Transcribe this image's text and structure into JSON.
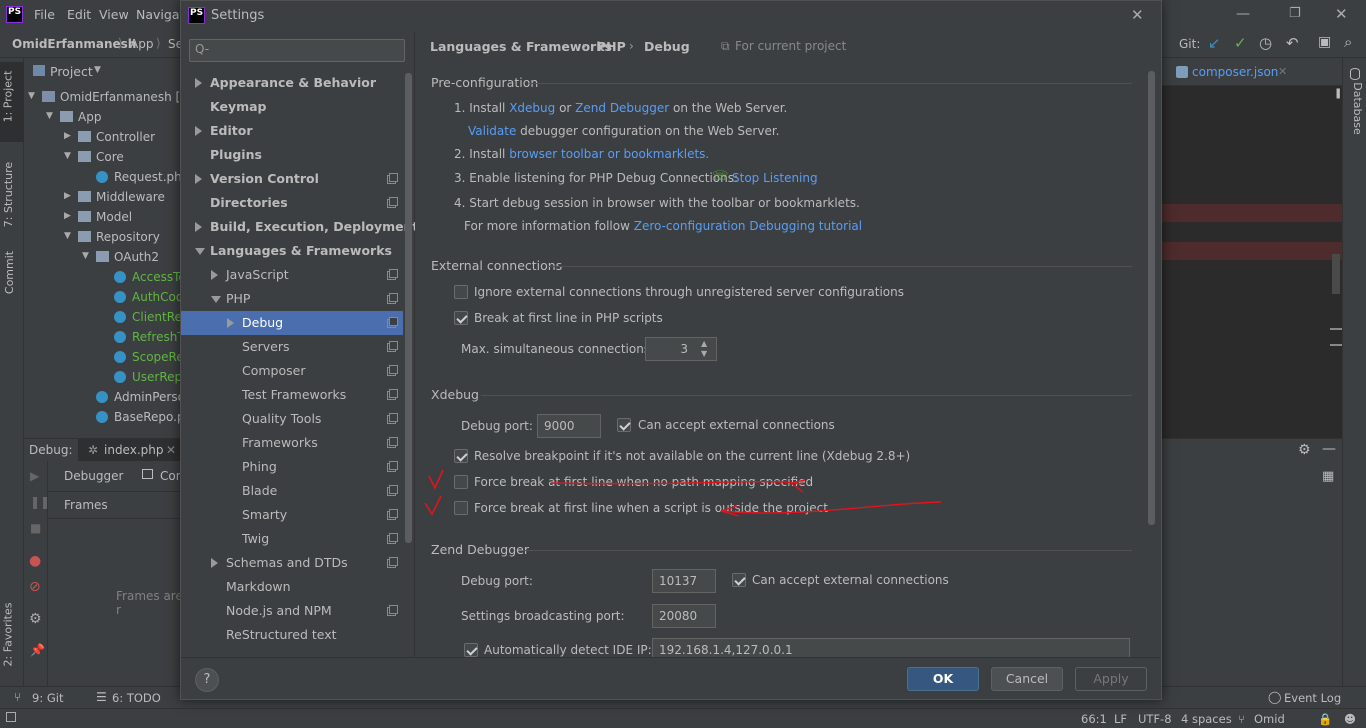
{
  "ide": {
    "menu": [
      "File",
      "Edit",
      "View",
      "Navigate"
    ],
    "breadcrumb": [
      "OmidErfanmanesh",
      "App",
      "Se"
    ],
    "vcs_label": "Git:",
    "project_tool": "Project",
    "left_stripe": [
      "1: Project",
      "7: Structure",
      "Commit",
      "2: Favorites"
    ],
    "right_stripe": [
      "Database"
    ],
    "editor_tab": "composer.json",
    "tree": [
      {
        "label": "OmidErfanmanesh [Pe",
        "indent": 0,
        "type": "module",
        "open": true
      },
      {
        "label": "App",
        "indent": 1,
        "type": "folder",
        "open": true
      },
      {
        "label": "Controller",
        "indent": 2,
        "type": "folder",
        "open": false
      },
      {
        "label": "Core",
        "indent": 2,
        "type": "folder",
        "open": true
      },
      {
        "label": "Request.php",
        "indent": 3,
        "type": "class",
        "open": null
      },
      {
        "label": "Middleware",
        "indent": 2,
        "type": "folder",
        "open": false
      },
      {
        "label": "Model",
        "indent": 2,
        "type": "folder",
        "open": false
      },
      {
        "label": "Repository",
        "indent": 2,
        "type": "folder",
        "open": true
      },
      {
        "label": "OAuth2",
        "indent": 3,
        "type": "folder",
        "open": true
      },
      {
        "label": "AccessTo",
        "indent": 4,
        "type": "class-green",
        "open": null
      },
      {
        "label": "AuthCod",
        "indent": 4,
        "type": "class-green",
        "open": null
      },
      {
        "label": "ClientRep",
        "indent": 4,
        "type": "class-green",
        "open": null
      },
      {
        "label": "RefreshT",
        "indent": 4,
        "type": "class-green",
        "open": null
      },
      {
        "label": "ScopeRe",
        "indent": 4,
        "type": "class-green",
        "open": null
      },
      {
        "label": "UserRepo",
        "indent": 4,
        "type": "class-green",
        "open": null
      },
      {
        "label": "AdminPerso",
        "indent": 3,
        "type": "class",
        "open": null
      },
      {
        "label": "BaseRepo.pl",
        "indent": 3,
        "type": "class",
        "open": null
      }
    ],
    "debug": {
      "label": "Debug:",
      "tab": "index.php",
      "subtabs": [
        "Debugger",
        "Con"
      ],
      "frames_header": "Frames",
      "frames_empty": "Frames are r"
    },
    "bottom_tools": [
      "9: Git",
      "6: TODO"
    ],
    "event_log": "Event Log",
    "status": {
      "position": "66:1",
      "line_sep": "LF",
      "encoding": "UTF-8",
      "indent": "4 spaces",
      "branch": "Omid"
    }
  },
  "dialog": {
    "title": "Settings",
    "search_placeholder": "Q-",
    "breadcrumb": [
      "Languages & Frameworks",
      "PHP",
      "Debug"
    ],
    "scope_note": "For current project",
    "nav": [
      {
        "label": "Appearance & Behavior",
        "bold": true,
        "indent": 0,
        "arrow": "right",
        "page_icon": false,
        "selected": false
      },
      {
        "label": "Keymap",
        "bold": true,
        "indent": 0,
        "arrow": null,
        "page_icon": false,
        "selected": false
      },
      {
        "label": "Editor",
        "bold": true,
        "indent": 0,
        "arrow": "right",
        "page_icon": false,
        "selected": false
      },
      {
        "label": "Plugins",
        "bold": true,
        "indent": 0,
        "arrow": null,
        "page_icon": false,
        "selected": false
      },
      {
        "label": "Version Control",
        "bold": true,
        "indent": 0,
        "arrow": "right",
        "page_icon": true,
        "selected": false
      },
      {
        "label": "Directories",
        "bold": true,
        "indent": 0,
        "arrow": null,
        "page_icon": true,
        "selected": false
      },
      {
        "label": "Build, Execution, Deployment",
        "bold": true,
        "indent": 0,
        "arrow": "right",
        "page_icon": false,
        "selected": false
      },
      {
        "label": "Languages & Frameworks",
        "bold": true,
        "indent": 0,
        "arrow": "down",
        "page_icon": false,
        "selected": false
      },
      {
        "label": "JavaScript",
        "bold": false,
        "indent": 1,
        "arrow": "right",
        "page_icon": true,
        "selected": false
      },
      {
        "label": "PHP",
        "bold": false,
        "indent": 1,
        "arrow": "down",
        "page_icon": true,
        "selected": false
      },
      {
        "label": "Debug",
        "bold": false,
        "indent": 2,
        "arrow": "right",
        "page_icon": true,
        "selected": true
      },
      {
        "label": "Servers",
        "bold": false,
        "indent": 2,
        "arrow": null,
        "page_icon": true,
        "selected": false
      },
      {
        "label": "Composer",
        "bold": false,
        "indent": 2,
        "arrow": null,
        "page_icon": true,
        "selected": false
      },
      {
        "label": "Test Frameworks",
        "bold": false,
        "indent": 2,
        "arrow": null,
        "page_icon": true,
        "selected": false
      },
      {
        "label": "Quality Tools",
        "bold": false,
        "indent": 2,
        "arrow": null,
        "page_icon": true,
        "selected": false
      },
      {
        "label": "Frameworks",
        "bold": false,
        "indent": 2,
        "arrow": null,
        "page_icon": true,
        "selected": false
      },
      {
        "label": "Phing",
        "bold": false,
        "indent": 2,
        "arrow": null,
        "page_icon": true,
        "selected": false
      },
      {
        "label": "Blade",
        "bold": false,
        "indent": 2,
        "arrow": null,
        "page_icon": true,
        "selected": false
      },
      {
        "label": "Smarty",
        "bold": false,
        "indent": 2,
        "arrow": null,
        "page_icon": true,
        "selected": false
      },
      {
        "label": "Twig",
        "bold": false,
        "indent": 2,
        "arrow": null,
        "page_icon": true,
        "selected": false
      },
      {
        "label": "Schemas and DTDs",
        "bold": false,
        "indent": 1,
        "arrow": "right",
        "page_icon": true,
        "selected": false
      },
      {
        "label": "Markdown",
        "bold": false,
        "indent": 1,
        "arrow": null,
        "page_icon": false,
        "selected": false
      },
      {
        "label": "Node.js and NPM",
        "bold": false,
        "indent": 1,
        "arrow": null,
        "page_icon": true,
        "selected": false
      },
      {
        "label": "ReStructured text",
        "bold": false,
        "indent": 1,
        "arrow": null,
        "page_icon": false,
        "selected": false
      }
    ],
    "preconfig": {
      "title": "Pre-configuration",
      "step1_prefix": "1. Install ",
      "step1_xdebug": "Xdebug",
      "step1_or": " or ",
      "step1_zend": "Zend Debugger",
      "step1_suffix": " on the Web Server.",
      "validate_link": "Validate",
      "validate_text": " debugger configuration on the Web Server.",
      "step2_prefix": "2. Install ",
      "step2_link": "browser toolbar or bookmarklets.",
      "step3": "3. Enable listening for PHP Debug Connections:",
      "step3_link": "Stop Listening",
      "step4": "4. Start debug session in browser with the toolbar or bookmarklets.",
      "more_info": "For more information follow ",
      "more_info_link": "Zero-configuration Debugging tutorial"
    },
    "external": {
      "title": "External connections",
      "ignore_label": "Ignore external connections through unregistered server configurations",
      "ignore_checked": false,
      "break_label": "Break at first line in PHP scripts",
      "break_checked": true,
      "max_label": "Max. simultaneous connections:",
      "max_value": "3"
    },
    "xdebug": {
      "title": "Xdebug",
      "port_label": "Debug port:",
      "port_value": "9000",
      "accept_label": "Can accept external connections",
      "accept_checked": true,
      "resolve_label": "Resolve breakpoint if it's not available on the current line (Xdebug 2.8+)",
      "resolve_checked": true,
      "force_mapping_label": "Force break at first line when no path mapping specified",
      "force_mapping_checked": false,
      "force_outside_label": "Force break at first line when a script is outside the project",
      "force_outside_checked": false
    },
    "zend": {
      "title": "Zend Debugger",
      "port_label": "Debug port:",
      "port_value": "10137",
      "accept_label": "Can accept external connections",
      "accept_checked": true,
      "broadcast_label": "Settings broadcasting port:",
      "broadcast_value": "20080",
      "auto_ip_label": "Automatically detect IDE IP:",
      "auto_ip_checked": true,
      "ip_value": "192.168.1.4,127.0.0.1"
    },
    "buttons": {
      "ok": "OK",
      "cancel": "Cancel",
      "apply": "Apply",
      "help": "?"
    }
  },
  "colors": {
    "accent": "#4b6eaf",
    "link": "#589df6",
    "annotation": "#e0141e",
    "green": "#62b543"
  }
}
